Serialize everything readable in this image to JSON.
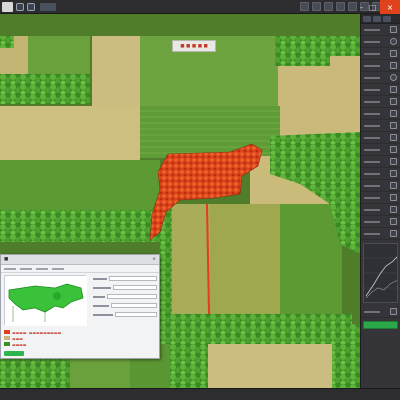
{
  "colors": {
    "accent": "#2fb44d",
    "close": "#e0431b",
    "fire": "#d9421b",
    "forest": "#3c8f22",
    "field_light": "#c9b879",
    "field_green": "#5f9b37"
  },
  "titlebar": {
    "menus": [
      "",
      "",
      "",
      "",
      "",
      "",
      "",
      "",
      "",
      "",
      ""
    ],
    "icons": [
      "app-logo-icon",
      "save-icon",
      "undo-icon"
    ]
  },
  "canvas": {
    "map_label": "■ ■ ■ ■ ■"
  },
  "statusbar": {
    "items": [
      "",
      "",
      "",
      "",
      ""
    ]
  },
  "rpanel": {
    "swatch_label": ""
  }
}
